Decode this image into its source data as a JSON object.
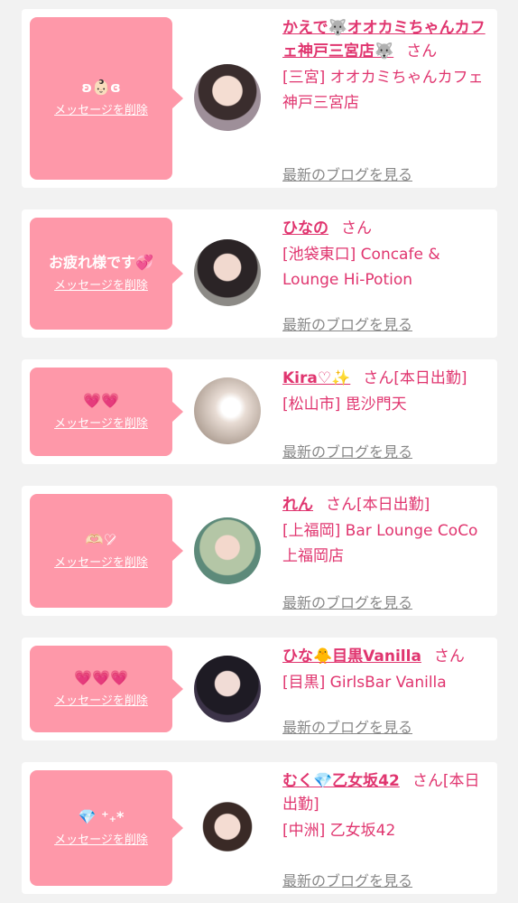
{
  "delete_label": "メッセージを削除",
  "blog_label": "最新のブログを見る",
  "suffix": "さん",
  "colors": {
    "accent": "#e0356f",
    "bubble": "#fe98a9",
    "muted": "#888888"
  },
  "cards": [
    {
      "message": "ʚ👶🏻ɞ",
      "name": "かえで🐺オオカミちゃんカフェ神戸三宮店🐺",
      "tag": "",
      "shop": "[三宮] オオカミちゃんカフェ神戸三宮店",
      "avatar_icon": "avatar-photo"
    },
    {
      "message": "お疲れ様です💞",
      "name": "ひなの",
      "tag": "",
      "shop": "[池袋東口] Concafe & Lounge Hi-Potion",
      "avatar_icon": "avatar-photo"
    },
    {
      "message": "💗💗",
      "name": "Kira♡✨",
      "tag": "[本日出勤]",
      "shop": "[松山市] 毘沙門天",
      "avatar_icon": "avatar-photo"
    },
    {
      "message": "🫶🏻♡̷",
      "name": "れん",
      "tag": "[本日出勤]",
      "shop": "[上福岡] Bar Lounge CoCo 上福岡店",
      "avatar_icon": "avatar-photo"
    },
    {
      "message": "💗💗💗",
      "name": "ひな🐥目黒Vanilla",
      "tag": "",
      "shop": "[目黒] GirlsBar Vanilla",
      "avatar_icon": "avatar-photo"
    },
    {
      "message": "💎 ⁺₊*",
      "name": "むく💎乙女坂42",
      "tag": "[本日出勤]",
      "shop": "[中洲] 乙女坂42",
      "avatar_icon": "avatar-photo"
    }
  ]
}
